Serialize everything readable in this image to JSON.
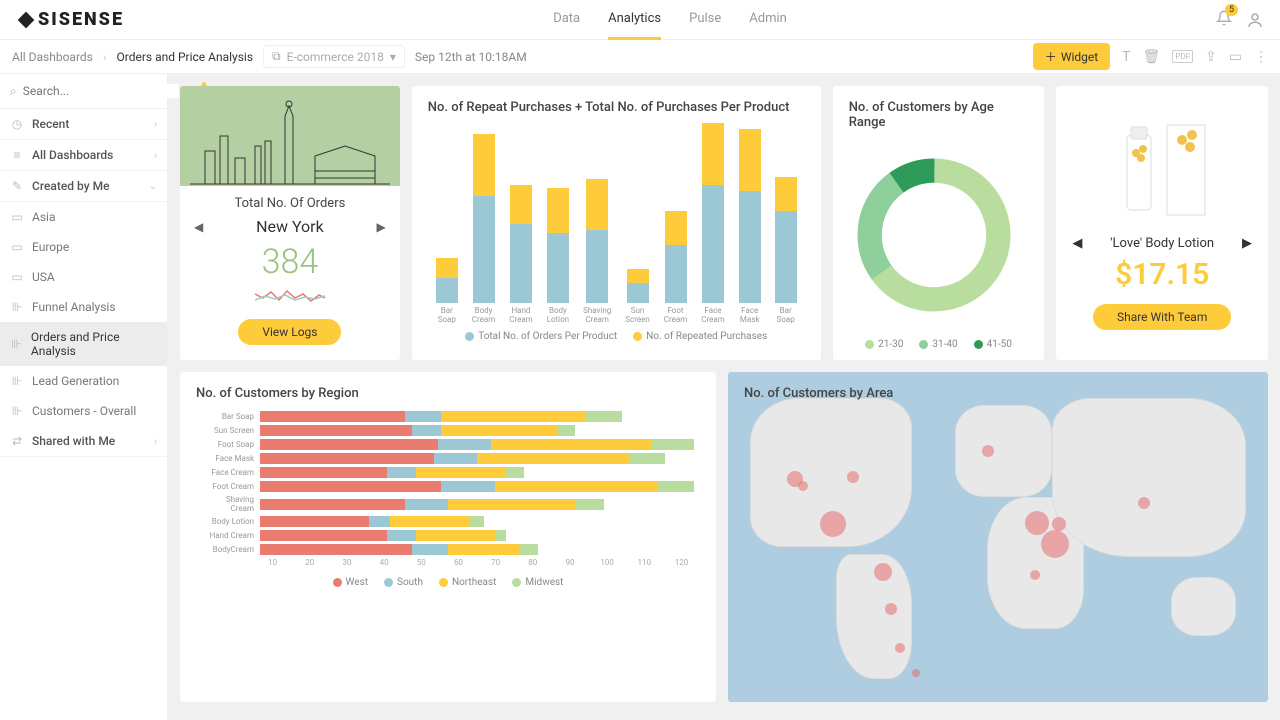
{
  "colors": {
    "accent": "#fecb3a",
    "blue": "#9bc8d4",
    "green1": "#b9dd9f",
    "green2": "#8fcf9b",
    "green3": "#2f9b5b",
    "coral": "#e97c6e",
    "orange": "#f4b66e"
  },
  "topnav": {
    "items": [
      "Data",
      "Analytics",
      "Pulse",
      "Admin"
    ],
    "active": "Analytics",
    "badge": "5"
  },
  "breadcrumb": {
    "root": "All Dashboards",
    "current": "Orders and Price Analysis",
    "filter": "E-commerce 2018",
    "timestamp": "Sep 12th at 10:18AM",
    "widget_btn": "Widget"
  },
  "sidebar": {
    "search_placeholder": "Search...",
    "recent": "Recent",
    "all": "All Dashboards",
    "created": "Created by Me",
    "shared": "Shared with Me",
    "folders": [
      "Asia",
      "Europe",
      "USA",
      "Funnel Analysis",
      "Orders and Price Analysis",
      "Lead Generation",
      "Customers - Overall"
    ],
    "active": "Orders and Price Analysis"
  },
  "card_orders": {
    "title": "Total No. Of Orders",
    "city": "New York",
    "value": "384",
    "btn": "View Logs"
  },
  "card_product": {
    "name": "'Love' Body Lotion",
    "price": "$17.15",
    "btn": "Share With Team"
  },
  "card_bar": {
    "title": "No. of Repeat Purchases + Total No. of Purchases Per Product",
    "legend_a": "Total No. of Orders Per Product",
    "legend_b": "No. of Repeated Purchases"
  },
  "card_donut": {
    "title": "No. of Customers by Age Range",
    "legend": [
      "21-30",
      "31-40",
      "41-50"
    ]
  },
  "card_region": {
    "title": "No. of Customers by Region",
    "legend": [
      "West",
      "South",
      "Northeast",
      "Midwest"
    ]
  },
  "card_area": {
    "title": "No. of Customers by Area"
  },
  "chart_data": {
    "purchases_bar": {
      "type": "bar",
      "stacked": true,
      "categories": [
        "Bar Soap",
        "Body Cream",
        "Hand Cream",
        "Body Lotion",
        "Shaving Cream",
        "Sun Screen",
        "Foot Cream",
        "Face Cream",
        "Face Mask",
        "Bar Soap"
      ],
      "series": [
        {
          "name": "Total No. of Orders Per Product",
          "color": "#9bc8d4",
          "values": [
            22,
            95,
            70,
            62,
            65,
            18,
            52,
            105,
            100,
            82
          ]
        },
        {
          "name": "No. of Repeated Purchases",
          "color": "#fecb3a",
          "values": [
            18,
            55,
            35,
            40,
            45,
            12,
            30,
            55,
            55,
            30
          ]
        }
      ],
      "ylim": [
        0,
        160
      ]
    },
    "age_donut": {
      "type": "pie",
      "donut": true,
      "slices": [
        {
          "label": "21-30",
          "value": 65,
          "color": "#b9dd9f"
        },
        {
          "label": "31-40",
          "value": 25,
          "color": "#8fcf9b"
        },
        {
          "label": "41-50",
          "value": 10,
          "color": "#2f9b5b"
        }
      ]
    },
    "region_hbar": {
      "type": "bar",
      "orientation": "horizontal",
      "stacked": true,
      "categories": [
        "Bar Soap",
        "Sun Screen",
        "Foot Soap",
        "Face Mask",
        "Face Cream",
        "Foot Cream",
        "Shaving Cream",
        "Body Lotion",
        "Hand Cream",
        "BodyCream"
      ],
      "series": [
        {
          "name": "West",
          "color": "#e97c6e",
          "values": [
            40,
            42,
            50,
            48,
            35,
            50,
            40,
            30,
            35,
            42
          ]
        },
        {
          "name": "South",
          "color": "#9bc8d4",
          "values": [
            10,
            8,
            15,
            12,
            8,
            15,
            12,
            6,
            8,
            10
          ]
        },
        {
          "name": "Northeast",
          "color": "#fecb3a",
          "values": [
            40,
            32,
            45,
            42,
            25,
            45,
            35,
            22,
            22,
            20
          ]
        },
        {
          "name": "Midwest",
          "color": "#b9dd9f",
          "values": [
            10,
            5,
            12,
            10,
            5,
            10,
            8,
            4,
            3,
            5
          ]
        }
      ],
      "xlim": [
        0,
        120
      ],
      "xticks": [
        10,
        20,
        30,
        40,
        50,
        60,
        70,
        80,
        90,
        100,
        110,
        120
      ]
    }
  }
}
